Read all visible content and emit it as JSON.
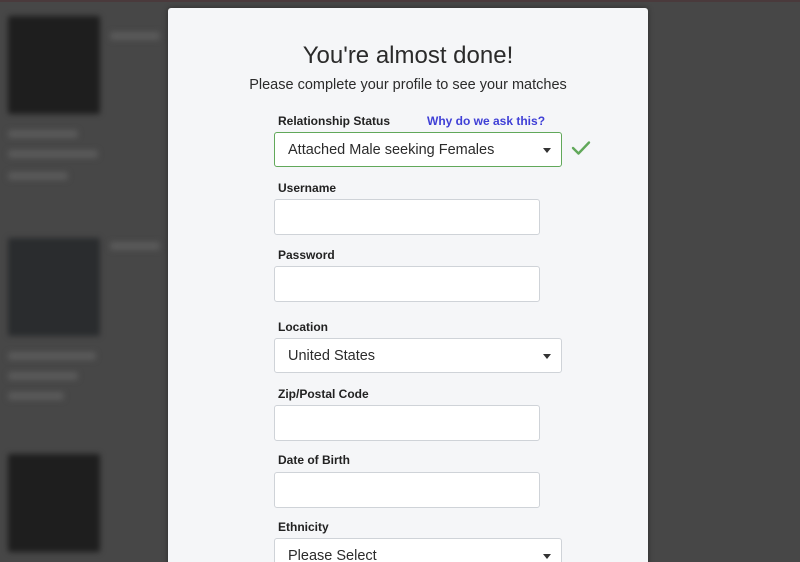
{
  "modal": {
    "title": "You're almost done!",
    "subtitle": "Please complete your profile to see your matches"
  },
  "form": {
    "relationship_status": {
      "label": "Relationship Status",
      "help_link": "Why do we ask this?",
      "value": "Attached Male seeking Females",
      "valid_icon": "checkmark-icon"
    },
    "username": {
      "label": "Username",
      "value": ""
    },
    "password": {
      "label": "Password",
      "value": ""
    },
    "location": {
      "label": "Location",
      "value": "United States"
    },
    "zip": {
      "label": "Zip/Postal Code",
      "value": ""
    },
    "dob": {
      "label": "Date of Birth",
      "value": ""
    },
    "ethnicity": {
      "label": "Ethnicity",
      "value": "Please Select"
    }
  },
  "colors": {
    "valid_green": "#61a85a",
    "link_blue": "#3f3fd6"
  }
}
